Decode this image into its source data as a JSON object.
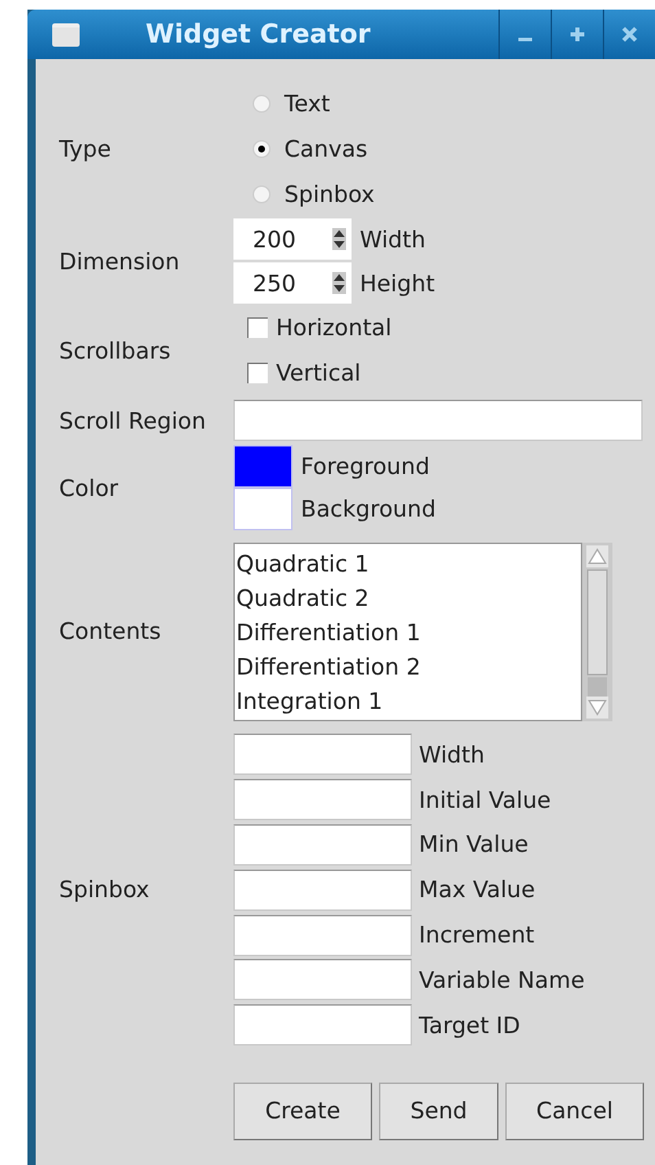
{
  "window": {
    "title": "Widget Creator"
  },
  "type": {
    "label": "Type",
    "options": [
      {
        "label": "Text",
        "selected": false
      },
      {
        "label": "Canvas",
        "selected": true
      },
      {
        "label": "Spinbox",
        "selected": false
      }
    ]
  },
  "dimension": {
    "label": "Dimension",
    "fields": [
      {
        "value": "200",
        "label": "Width"
      },
      {
        "value": "250",
        "label": "Height"
      }
    ]
  },
  "scrollbars": {
    "label": "Scrollbars",
    "options": [
      {
        "label": "Horizontal",
        "checked": false
      },
      {
        "label": "Vertical",
        "checked": false
      }
    ]
  },
  "scroll_region": {
    "label": "Scroll Region"
  },
  "color": {
    "label": "Color",
    "swatches": [
      {
        "label": "Foreground",
        "color": "#0000ff"
      },
      {
        "label": "Background",
        "color": "#ffffff"
      }
    ]
  },
  "contents": {
    "label": "Contents",
    "items": [
      "Quadratic 1",
      "Quadratic 2",
      "Differentiation 1",
      "Differentiation 2",
      "Integration 1"
    ]
  },
  "spinbox": {
    "label": "Spinbox",
    "fields": [
      "Width",
      "Initial Value",
      "Min Value",
      "Max Value",
      "Increment",
      "Variable Name",
      "Target ID"
    ]
  },
  "buttons": [
    "Create",
    "Send",
    "Cancel"
  ]
}
